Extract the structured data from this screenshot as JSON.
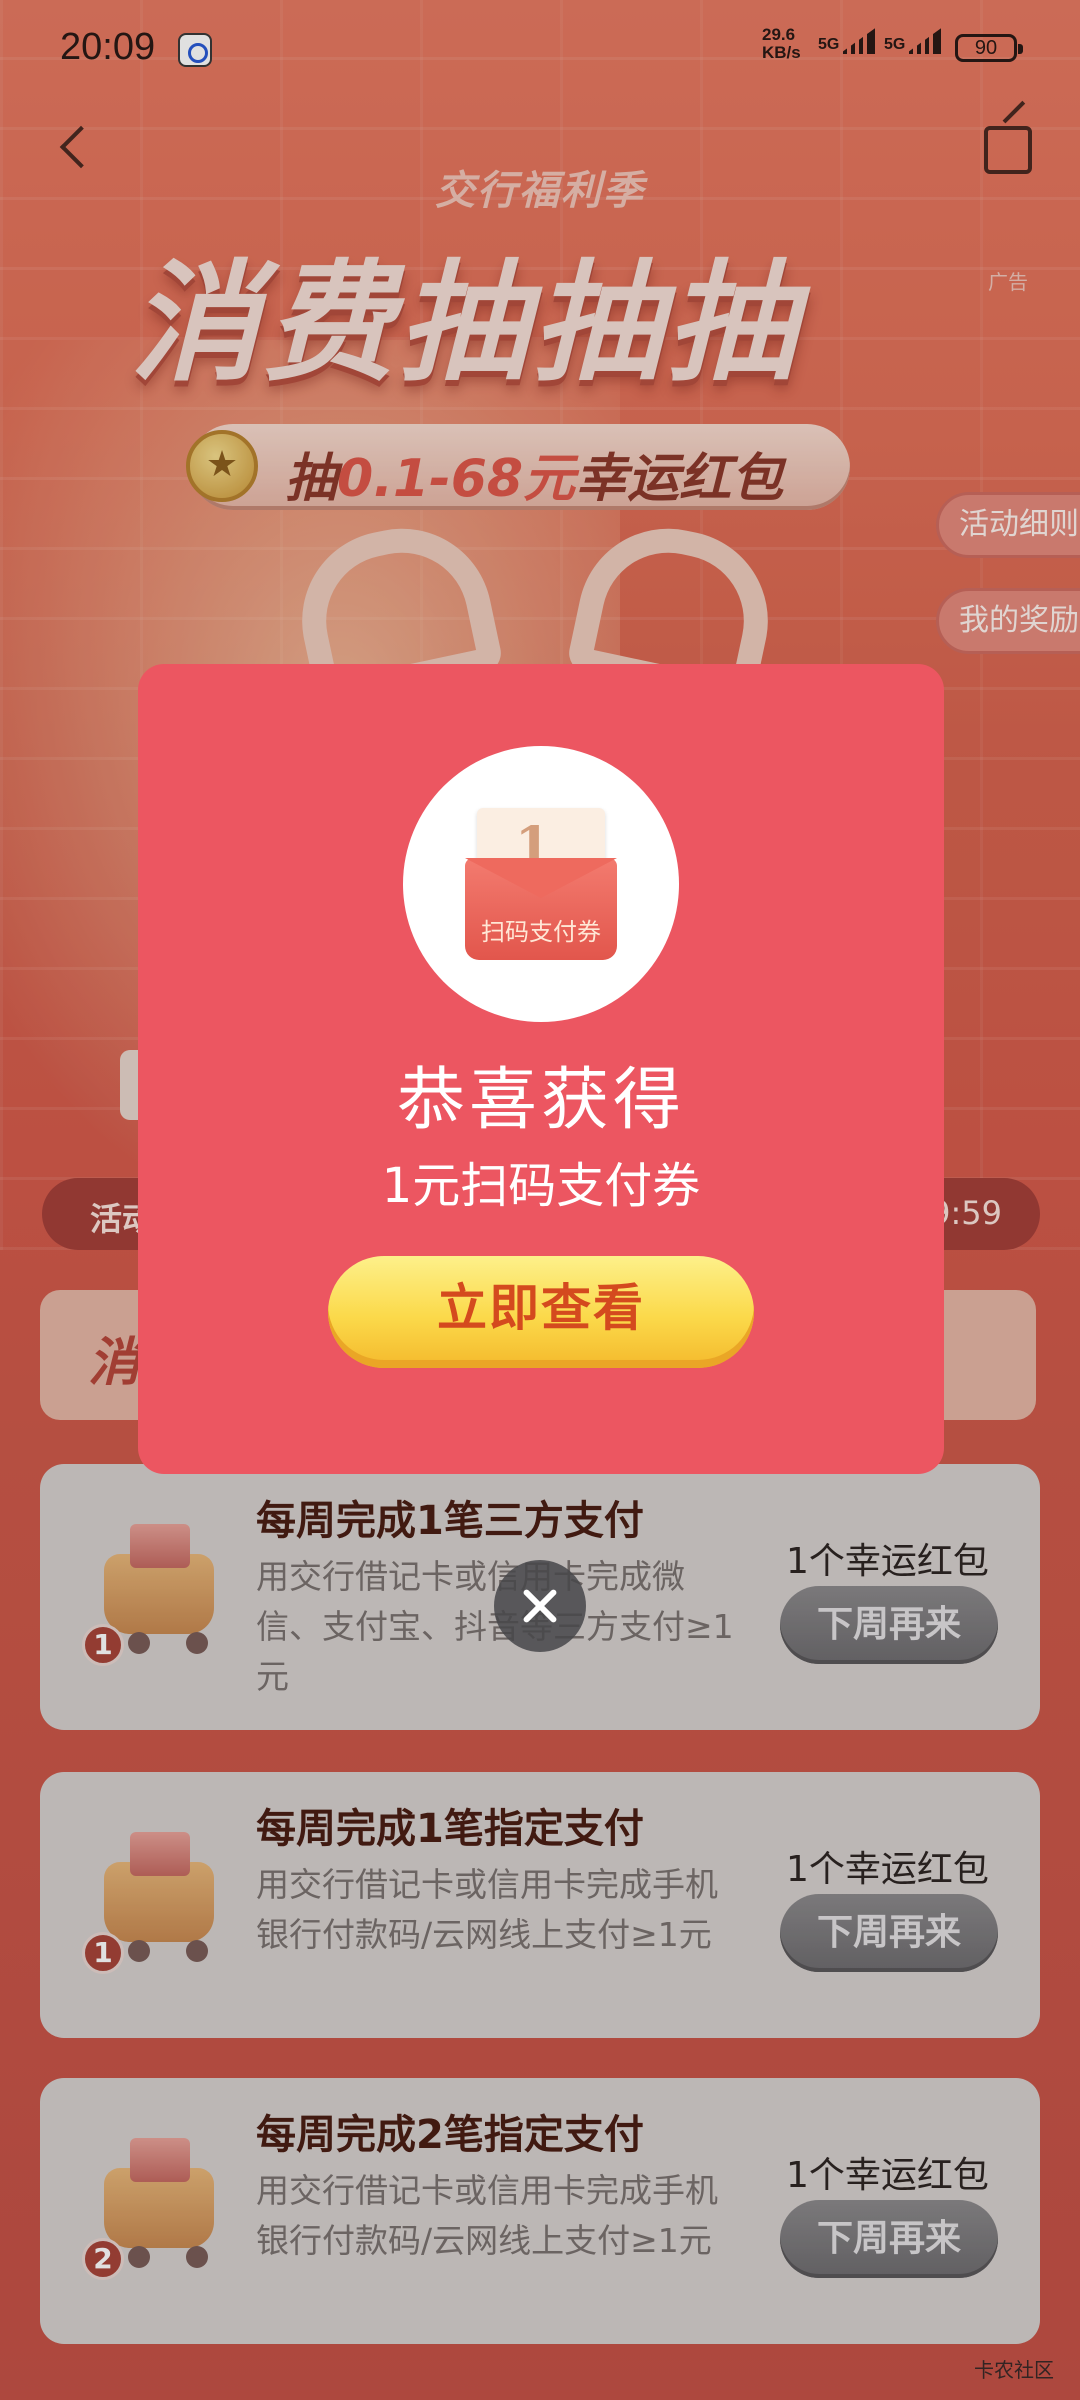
{
  "status_bar": {
    "time": "20:09",
    "net_speed_value": "29.6",
    "net_speed_unit": "KB/s",
    "signal1": "5G",
    "signal2": "5G",
    "battery": "90"
  },
  "header": {
    "brand_sub": "交行福利季",
    "hero_title": "消费抽抽抽",
    "ad_tag": "广告",
    "prize_prefix": "抽",
    "prize_amount": "0.1-68元",
    "prize_suffix": "幸运红包"
  },
  "side_buttons": {
    "rules": "活动细则",
    "my_rewards": "我的奖励"
  },
  "background": {
    "activity_label": "活动",
    "countdown_partial": "9:59",
    "banner_partial": "消"
  },
  "tasks": [
    {
      "badge": "1",
      "title": "每周完成1笔三方支付",
      "desc": "用交行借记卡或信用卡完成微信、支付宝、抖音等三方支付≥1元",
      "reward": "1个幸运红包",
      "button": "下周再来"
    },
    {
      "badge": "1",
      "title": "每周完成1笔指定支付",
      "desc": "用交行借记卡或信用卡完成手机银行付款码/云网线上支付≥1元",
      "reward": "1个幸运红包",
      "button": "下周再来"
    },
    {
      "badge": "2",
      "title": "每周完成2笔指定支付",
      "desc": "用交行借记卡或信用卡完成手机银行付款码/云网线上支付≥1元",
      "reward": "1个幸运红包",
      "button": "下周再来"
    }
  ],
  "modal": {
    "coupon_value": "1",
    "coupon_unit": "元",
    "coupon_label": "扫码支付券",
    "congrats": "恭喜获得",
    "prize_name": "1元扫码支付券",
    "view_button": "立即查看"
  },
  "watermark": "卡农社区",
  "icons": {
    "back": "chevron-left-icon",
    "share": "share-icon",
    "close": "close-icon"
  },
  "colors": {
    "modal_bg": "#ec5661",
    "view_button": "#fbd94a",
    "disabled_button": "#7a787b"
  }
}
